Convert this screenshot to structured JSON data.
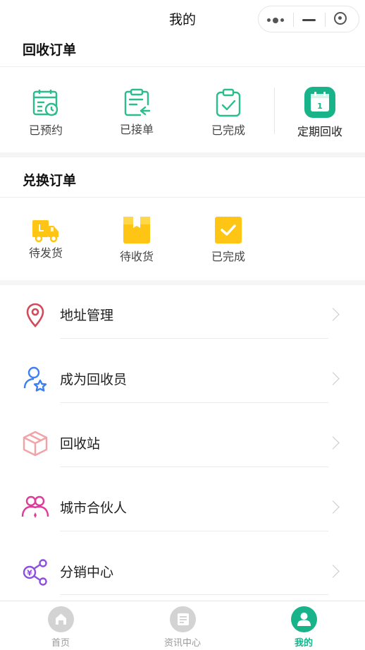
{
  "header": {
    "title": "我的"
  },
  "recycle_orders": {
    "title": "回收订单",
    "items": [
      {
        "label": "已预约",
        "icon": "calendar-clock-icon"
      },
      {
        "label": "已接单",
        "icon": "clipboard-receive-icon"
      },
      {
        "label": "已完成",
        "icon": "clipboard-check-icon"
      },
      {
        "label": "定期回收",
        "icon": "calendar-day-icon",
        "badge_number": "1"
      }
    ]
  },
  "exchange_orders": {
    "title": "兑换订单",
    "items": [
      {
        "label": "待发货",
        "icon": "delivery-truck-icon"
      },
      {
        "label": "待收货",
        "icon": "gift-box-icon"
      },
      {
        "label": "已完成",
        "icon": "checkbox-check-icon"
      }
    ]
  },
  "menu": [
    {
      "label": "地址管理",
      "icon": "location-pin-icon"
    },
    {
      "label": "成为回收员",
      "icon": "user-star-icon"
    },
    {
      "label": "回收站",
      "icon": "package-box-icon"
    },
    {
      "label": "城市合伙人",
      "icon": "people-group-icon"
    },
    {
      "label": "分销中心",
      "icon": "share-network-icon"
    }
  ],
  "tabbar": {
    "items": [
      {
        "label": "首页",
        "icon": "home-icon",
        "active": false
      },
      {
        "label": "资讯中心",
        "icon": "news-icon",
        "active": false
      },
      {
        "label": "我的",
        "icon": "profile-icon",
        "active": true
      }
    ]
  },
  "colors": {
    "accent": "#19b38a",
    "teal_icon": "#2bbd8e",
    "yellow_icon": "#ffc514",
    "tab_inactive": "#d3d3d3",
    "location": "#d24a5a",
    "user_star": "#3c7ff0",
    "box": "#f3a3a6",
    "people": "#e23a9a",
    "share": "#8c4fe0"
  }
}
